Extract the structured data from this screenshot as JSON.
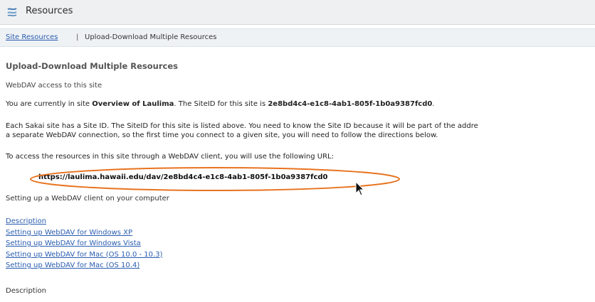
{
  "window": {
    "title": "Resources",
    "icon": "resources-icon"
  },
  "nav": {
    "site_resources_link": "Site Resources",
    "separator": "|",
    "current": "Upload-Download Multiple Resources"
  },
  "main": {
    "heading": "Upload-Download Multiple Resources",
    "subheading": "WebDAV access to this site",
    "current_site_prefix": "You are currently in site ",
    "site_name": "Overview of Laulima",
    "site_id_mid": ". The SiteID for this site is ",
    "site_id": "2e8bd4c4-e1c8-4ab1-805f-1b0a9387fcd0",
    "site_id_end": ".",
    "explain_line1": "Each Sakai site has a Site ID. The SiteID for this site is listed above. You need to know the Site ID because it will be part of the addre",
    "explain_line2": "a separate WebDAV connection, so the first time you connect to a given site, you will need to follow the directions below.",
    "access_line": "To access the resources in this site through a WebDAV client, you will use the following URL:",
    "url": "https://laulima.hawaii.edu/dav/2e8bd4c4-e1c8-4ab1-805f-1b0a9387fcd0",
    "setup_heading": "Setting up a WebDAV client on your computer",
    "links": [
      "Description",
      "Setting up WebDAV for Windows XP",
      "Setting up WebDAV for Windows Vista",
      "Setting up WebDAV for Mac (OS 10.0 - 10.3)",
      "Setting up WebDAV for Mac (OS 10.4)"
    ],
    "description_heading": "Description"
  },
  "colors": {
    "link": "#2a5db0",
    "highlight": "#e8731f",
    "titlebar": "#eef0f1"
  }
}
